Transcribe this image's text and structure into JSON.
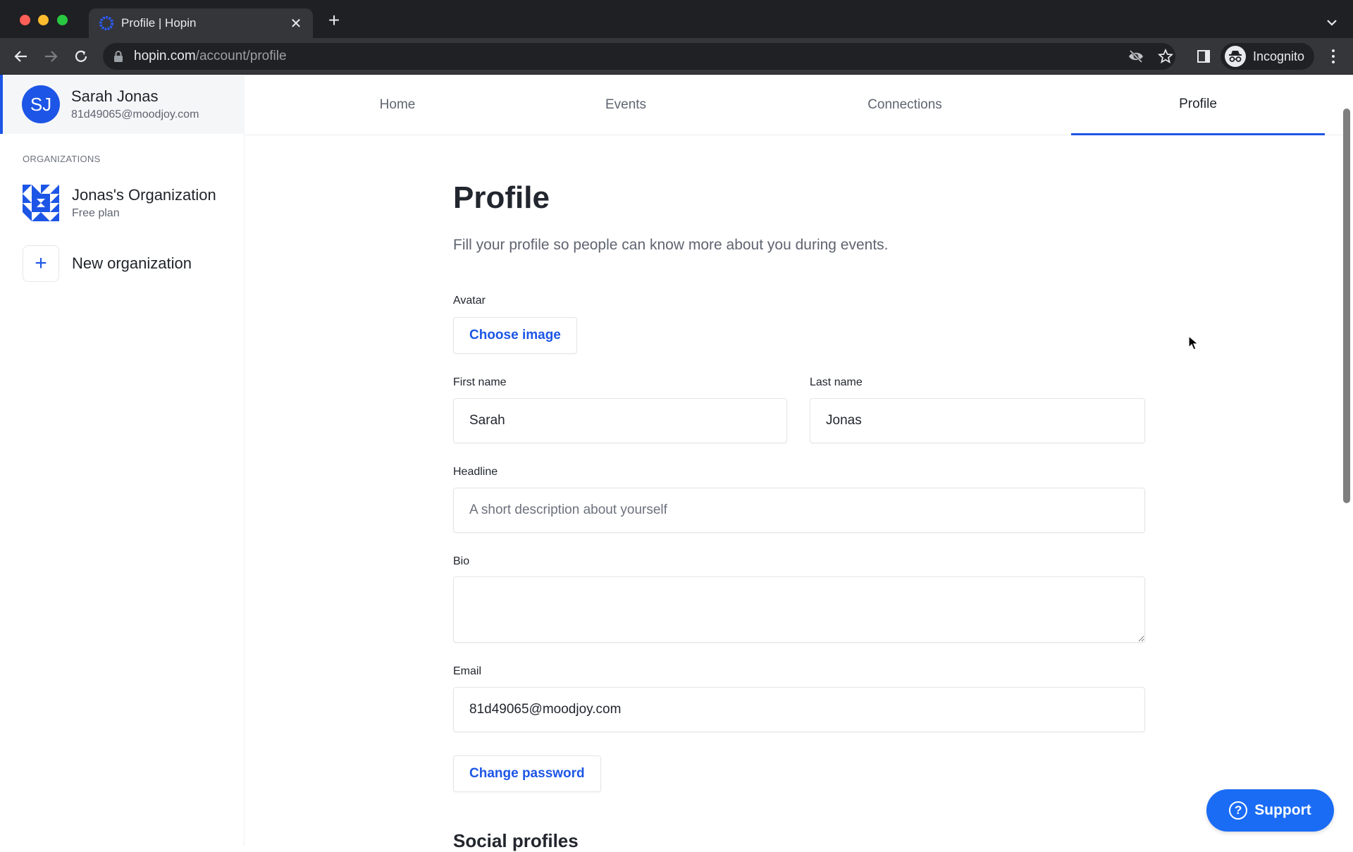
{
  "browser": {
    "tab_title": "Profile | Hopin",
    "url_host": "hopin.com",
    "url_path": "/account/profile",
    "profile_label": "Incognito"
  },
  "sidebar": {
    "user": {
      "initials": "SJ",
      "name": "Sarah Jonas",
      "email": "81d49065@moodjoy.com"
    },
    "organizations_heading": "ORGANIZATIONS",
    "organizations": [
      {
        "name": "Jonas's Organization",
        "plan": "Free plan"
      }
    ],
    "new_org_label": "New organization"
  },
  "topnav": {
    "tabs": [
      {
        "label": "Home",
        "active": false
      },
      {
        "label": "Events",
        "active": false
      },
      {
        "label": "Connections",
        "active": false
      },
      {
        "label": "Profile",
        "active": true
      }
    ]
  },
  "form": {
    "title": "Profile",
    "subtitle": "Fill your profile so people can know more about you during events.",
    "avatar_label": "Avatar",
    "choose_image_label": "Choose image",
    "first_name_label": "First name",
    "first_name_value": "Sarah",
    "last_name_label": "Last name",
    "last_name_value": "Jonas",
    "headline_label": "Headline",
    "headline_value": "",
    "headline_placeholder": "A short description about yourself",
    "bio_label": "Bio",
    "bio_value": "",
    "email_label": "Email",
    "email_value": "81d49065@moodjoy.com",
    "change_password_label": "Change password",
    "social_profiles_heading": "Social profiles"
  },
  "support": {
    "label": "Support",
    "icon": "?"
  },
  "colors": {
    "brand_blue": "#1d56e6",
    "support_blue": "#1a6cf5"
  }
}
